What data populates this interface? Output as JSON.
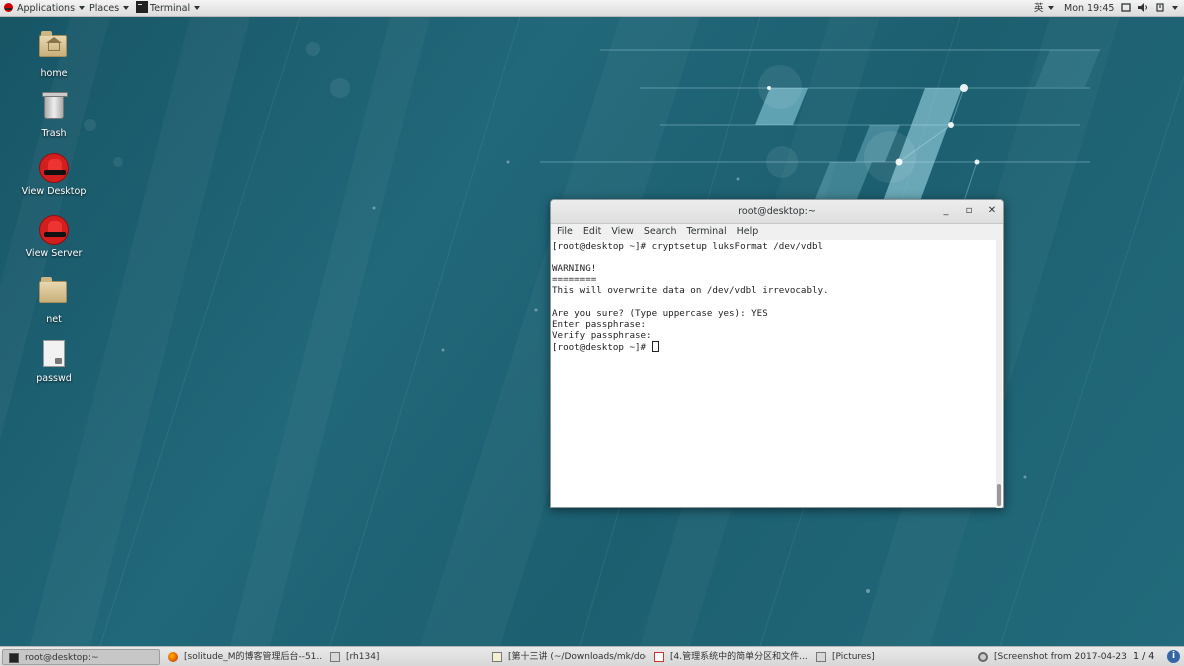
{
  "top_panel": {
    "applications": "Applications",
    "places": "Places",
    "active_app": "Terminal",
    "input_method": "英",
    "clock": "Mon 19:45"
  },
  "desktop_icons": [
    {
      "label": "home",
      "icon": "home-folder-icon"
    },
    {
      "label": "Trash",
      "icon": "trash-icon"
    },
    {
      "label": "View Desktop",
      "icon": "redhat-icon"
    },
    {
      "label": "View Server",
      "icon": "redhat-icon"
    },
    {
      "label": "net",
      "icon": "folder-icon"
    },
    {
      "label": "passwd",
      "icon": "locked-file-icon"
    }
  ],
  "terminal": {
    "title": "root@desktop:~",
    "menu": [
      "File",
      "Edit",
      "View",
      "Search",
      "Terminal",
      "Help"
    ],
    "lines": [
      "[root@desktop ~]# cryptsetup luksFormat /dev/vdbl",
      "",
      "WARNING!",
      "========",
      "This will overwrite data on /dev/vdbl irrevocably.",
      "",
      "Are you sure? (Type uppercase yes): YES",
      "Enter passphrase:",
      "Verify passphrase:"
    ],
    "prompt": "[root@desktop ~]# "
  },
  "taskbar": {
    "tasks": [
      {
        "label": "root@desktop:~",
        "icon": "terminal-icon",
        "active": true
      },
      {
        "label": "[solitude_M的博客管理后台--51...",
        "icon": "firefox-icon",
        "active": false
      },
      {
        "label": "[rh134]",
        "icon": "file-manager-icon",
        "active": false
      },
      {
        "label": "[第十三讲 (~/Downloads/mk/doc/...",
        "icon": "text-editor-icon",
        "active": false
      },
      {
        "label": "[4.管理系统中的简单分区和文件...",
        "icon": "document-viewer-icon",
        "active": false
      },
      {
        "label": "[Pictures]",
        "icon": "file-manager-icon",
        "active": false
      },
      {
        "label": "[Screenshot from 2017-04-23 ...",
        "icon": "screenshot-icon",
        "active": false
      }
    ],
    "workspace": "1 / 4"
  },
  "colors": {
    "wallpaper": "#1f6575",
    "panel": "#e8e8e8",
    "terminal_bg": "#ffffff"
  }
}
